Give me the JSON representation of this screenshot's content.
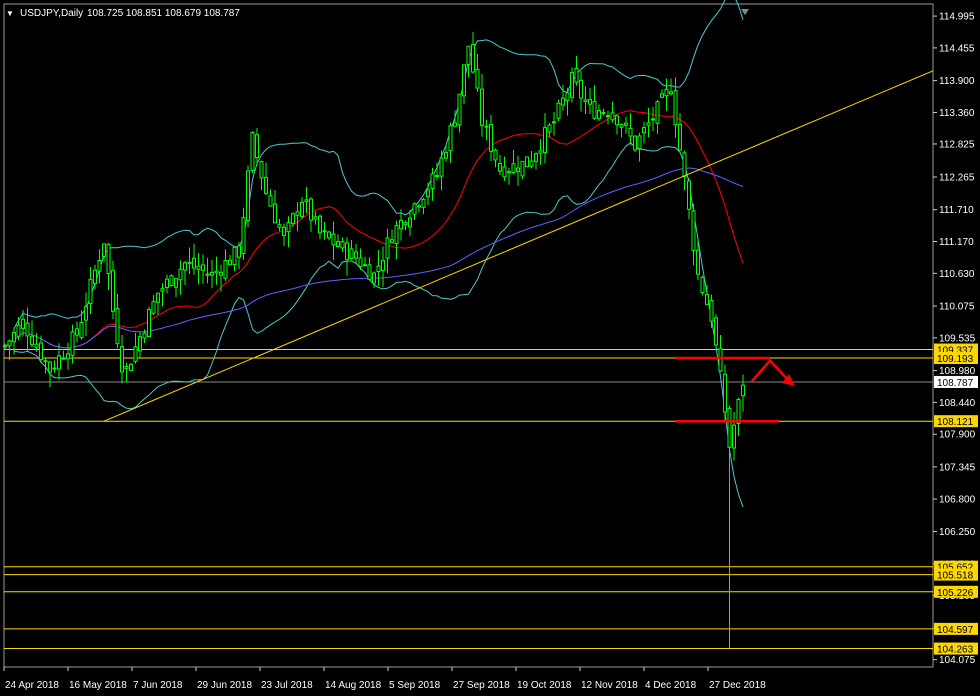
{
  "header": {
    "menu_glyph": "▼",
    "symbol": "USDJPY,Daily",
    "ohlc": "108.725 108.851 108.679 108.787"
  },
  "chart_data": {
    "type": "candlestick",
    "symbol": "USDJPY",
    "timeframe": "Daily",
    "ylim": [
      103.95,
      115.2
    ],
    "y_ticks": [
      "114.995",
      "114.455",
      "113.900",
      "113.360",
      "112.825",
      "112.265",
      "111.710",
      "111.170",
      "110.630",
      "110.075",
      "109.535",
      "108.980",
      "108.440",
      "107.900",
      "107.345",
      "106.800",
      "106.250",
      "105.700",
      "105.165",
      "104.610",
      "104.075"
    ],
    "x_labels": [
      "24 Apr 2018",
      "16 May 2018",
      "7 Jun 2018",
      "29 Jun 2018",
      "23 Jul 2018",
      "14 Aug 2018",
      "5 Sep 2018",
      "27 Sep 2018",
      "19 Oct 2018",
      "12 Nov 2018",
      "4 Dec 2018",
      "27 Dec 2018"
    ],
    "current_price": "108.787",
    "horizontal_levels": [
      "109.337",
      "109.193",
      "108.121",
      "105.652",
      "105.518",
      "105.226",
      "104.597",
      "104.263"
    ],
    "flash_crash_low": 104.263,
    "trend_line": {
      "from": [
        "16 May 2018",
        108.121
      ],
      "through": [
        "1 Nov 2018",
        111.8
      ]
    },
    "indicators": [
      "Bollinger Bands",
      "Moving Average",
      "Moving Average"
    ],
    "colors": {
      "background": "#000000",
      "candle": "#00ff00",
      "bollinger": "#4fc9c9",
      "ma_fast": "#ff0000",
      "ma_slow": "#6060ff",
      "levels": "#ffd700",
      "trend_line": "#ffd700",
      "annotation": "#ff0000",
      "label_bg": "#ffd700",
      "current_price_bg": "#ffffff"
    }
  }
}
